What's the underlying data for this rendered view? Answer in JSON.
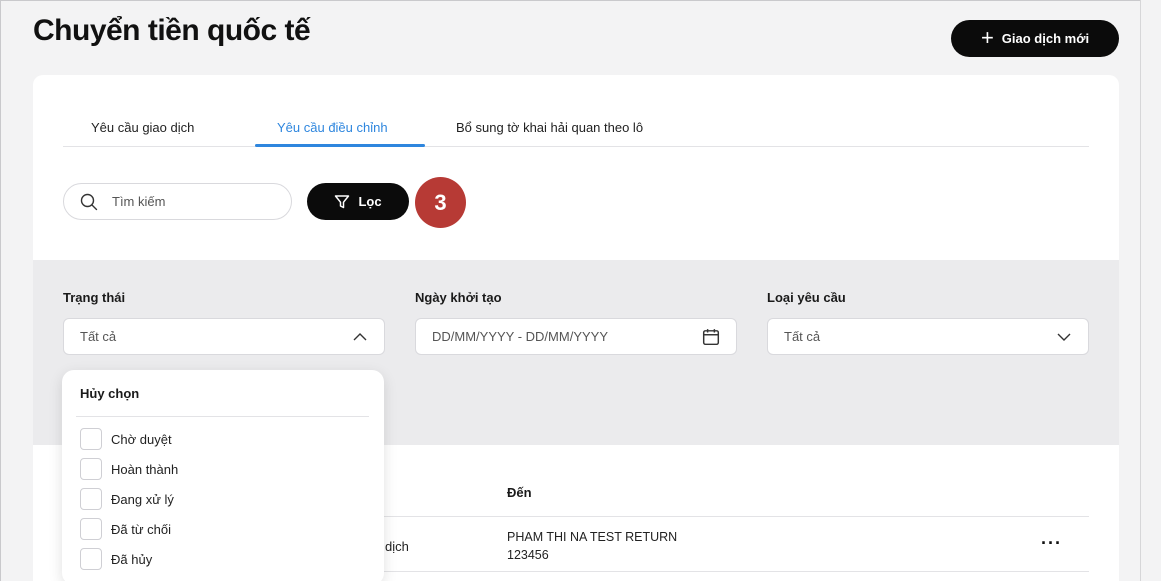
{
  "header": {
    "title": "Chuyển tiền quốc tế",
    "new_button_label": "Giao dịch mới"
  },
  "tabs": [
    {
      "label": "Yêu cầu giao dịch",
      "active": false
    },
    {
      "label": "Yêu cầu điều chỉnh",
      "active": true
    },
    {
      "label": "Bổ sung tờ khai hải quan theo lô",
      "active": false
    }
  ],
  "search": {
    "placeholder": "Tìm kiếm",
    "value": ""
  },
  "filter_button_label": "Lọc",
  "step_badge": "3",
  "filters": {
    "status": {
      "label": "Trạng thái",
      "value": "Tất cả"
    },
    "created_date": {
      "label": "Ngày khởi tạo",
      "placeholder": "DD/MM/YYYY - DD/MM/YYYY"
    },
    "request_type": {
      "label": "Loại yêu cầu",
      "value": "Tất cả"
    }
  },
  "status_dropdown": {
    "clear_label": "Hủy chọn",
    "options": [
      "Chờ duyệt",
      "Hoàn thành",
      "Đang xử lý",
      "Đã từ chối",
      "Đã hủy"
    ]
  },
  "table": {
    "header_to": "Đến",
    "rows": [
      {
        "type_partial": "dịch",
        "to_name": "PHAM THI NA TEST RETURN",
        "to_account": "123456"
      }
    ]
  },
  "colors": {
    "accent": "#2e86de",
    "badge": "#b73a35",
    "primary_button": "#0b0b0b"
  }
}
